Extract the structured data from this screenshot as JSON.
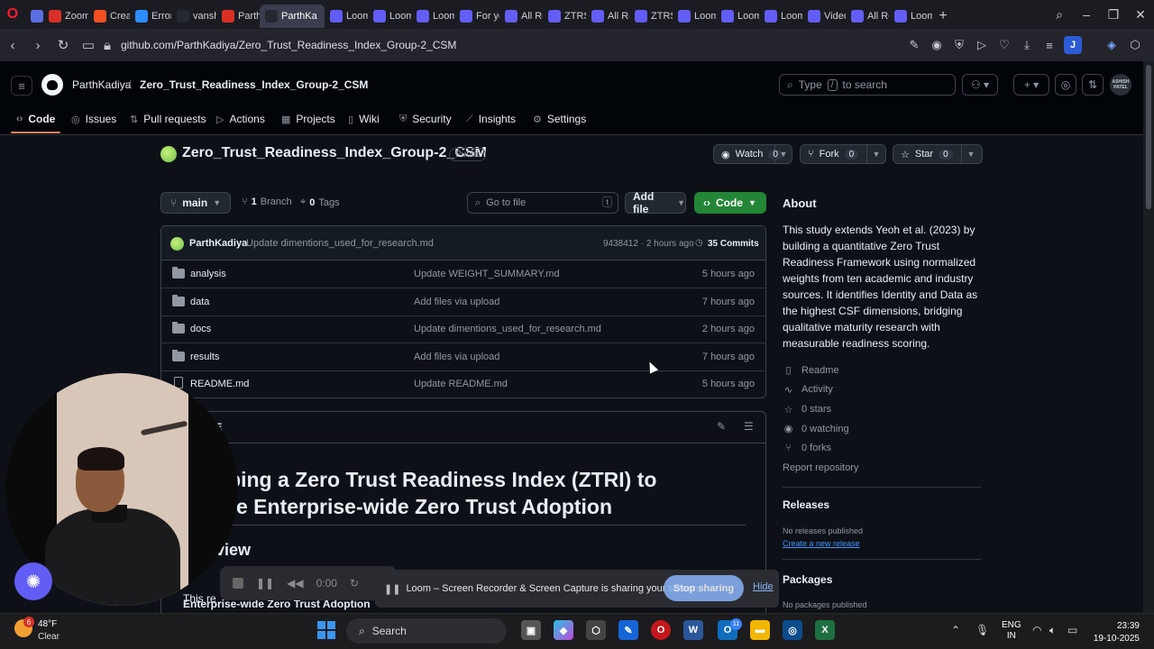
{
  "browser": {
    "tabs": [
      {
        "label": "",
        "icon": "settings-icon",
        "color": "#5b6ee1",
        "active": false
      },
      {
        "label": "Zoom",
        "icon": "gmail-icon",
        "color": "#d93025",
        "active": false
      },
      {
        "label": "Create",
        "icon": "microsoft-icon",
        "color": "#f25022",
        "active": false
      },
      {
        "label": "Error",
        "icon": "zoom-icon",
        "color": "#2d8cff",
        "active": false
      },
      {
        "label": "vansh",
        "icon": "github-icon",
        "color": "#24292f",
        "active": false
      },
      {
        "label": "Parth",
        "icon": "gmail-icon",
        "color": "#d93025",
        "active": false
      },
      {
        "label": "ParthKa",
        "icon": "github-icon",
        "color": "#24292f",
        "active": true
      },
      {
        "label": "Loom",
        "icon": "loom-icon",
        "color": "#625df5",
        "active": false
      },
      {
        "label": "Loom",
        "icon": "loom-icon",
        "color": "#625df5",
        "active": false
      },
      {
        "label": "Loom",
        "icon": "loom-icon",
        "color": "#625df5",
        "active": false
      },
      {
        "label": "For yo",
        "icon": "loom-icon",
        "color": "#625df5",
        "active": false
      },
      {
        "label": "All Re",
        "icon": "loom-icon",
        "color": "#625df5",
        "active": false
      },
      {
        "label": "ZTRS",
        "icon": "loom-icon",
        "color": "#625df5",
        "active": false
      },
      {
        "label": "All Re",
        "icon": "loom-icon",
        "color": "#625df5",
        "active": false
      },
      {
        "label": "ZTRS",
        "icon": "loom-icon",
        "color": "#625df5",
        "active": false
      },
      {
        "label": "Loom",
        "icon": "loom-icon",
        "color": "#625df5",
        "active": false
      },
      {
        "label": "Loom",
        "icon": "loom-icon",
        "color": "#625df5",
        "active": false
      },
      {
        "label": "Loom",
        "icon": "loom-icon",
        "color": "#625df5",
        "active": false
      },
      {
        "label": "Video",
        "icon": "loom-icon",
        "color": "#625df5",
        "active": false
      },
      {
        "label": "All Re",
        "icon": "loom-icon",
        "color": "#625df5",
        "active": false
      },
      {
        "label": "Loom",
        "icon": "loom-icon",
        "color": "#625df5",
        "active": false
      }
    ],
    "url": "github.com/ParthKadiya/Zero_Trust_Readiness_Index_Group-2_CSM",
    "profile_initial": "J"
  },
  "header": {
    "owner": "ParthKadiya",
    "separator": "/",
    "repo": "Zero_Trust_Readiness_Index_Group-2_CSM",
    "search_placeholder_pre": "Type",
    "search_key": "/",
    "search_placeholder_post": "to search",
    "avatar_text": "ASHISH PATEL"
  },
  "repo_nav": [
    {
      "label": "Code",
      "icon": "code-icon"
    },
    {
      "label": "Issues",
      "icon": "issue-icon"
    },
    {
      "label": "Pull requests",
      "icon": "pull-request-icon"
    },
    {
      "label": "Actions",
      "icon": "play-icon"
    },
    {
      "label": "Projects",
      "icon": "table-icon"
    },
    {
      "label": "Wiki",
      "icon": "book-icon"
    },
    {
      "label": "Security",
      "icon": "shield-icon"
    },
    {
      "label": "Insights",
      "icon": "graph-icon"
    },
    {
      "label": "Settings",
      "icon": "gear-icon"
    }
  ],
  "repo": {
    "title": "Zero_Trust_Readiness_Index_Group-2_CSM",
    "visibility": "Public",
    "watch_label": "Watch",
    "watch_count": "0",
    "fork_label": "Fork",
    "fork_count": "0",
    "star_label": "Star",
    "star_count": "0"
  },
  "toolbar": {
    "branch": "main",
    "branches_count": "1",
    "branches_label": "Branch",
    "tags_count": "0",
    "tags_label": "Tags",
    "goto_placeholder": "Go to file",
    "goto_key": "t",
    "add_file": "Add file",
    "code": "Code"
  },
  "latest_commit": {
    "author": "ParthKadiya",
    "message": "Update dimentions_used_for_research.md",
    "hash_time": "9438412 · 2 hours ago",
    "commits": "35 Commits"
  },
  "files": [
    {
      "name": "analysis",
      "type": "folder",
      "message": "Update WEIGHT_SUMMARY.md",
      "time": "5 hours ago"
    },
    {
      "name": "data",
      "type": "folder",
      "message": "Add files via upload",
      "time": "7 hours ago"
    },
    {
      "name": "docs",
      "type": "folder",
      "message": "Update dimentions_used_for_research.md",
      "time": "2 hours ago"
    },
    {
      "name": "results",
      "type": "folder",
      "message": "Add files via upload",
      "time": "7 hours ago"
    },
    {
      "name": "README.md",
      "type": "file",
      "message": "Update README.md",
      "time": "5 hours ago"
    }
  ],
  "readme": {
    "tab_label": "E",
    "title_line1": "oping a Zero Trust Readiness Index (ZTRI) to",
    "title_line2": "ure Enterprise-wide Zero Trust Adoption",
    "h2": "view",
    "para_pre": "This re",
    "para_bold": "Enterprise-wide Zero Trust Adoption"
  },
  "about": {
    "heading": "About",
    "description": "This study extends Yeoh et al. (2023) by building a quantitative Zero Trust Readiness Framework using normalized weights from ten academic and industry sources. It identifies Identity and Data as the highest CSF dimensions, bridging qualitative maturity research with measurable readiness scoring.",
    "links": [
      {
        "label": "Readme",
        "icon": "book-icon"
      },
      {
        "label": "Activity",
        "icon": "pulse-icon"
      },
      {
        "label": "0 stars",
        "icon": "star-icon"
      },
      {
        "label": "0 watching",
        "icon": "eye-icon"
      },
      {
        "label": "0 forks",
        "icon": "fork-icon"
      }
    ],
    "report": "Report repository",
    "releases_heading": "Releases",
    "releases_none": "No releases published",
    "releases_create": "Create a new release",
    "packages_heading": "Packages",
    "packages_none": "No packages published"
  },
  "loom": {
    "timer": "0:00",
    "share_text": "Loom – Screen Recorder & Screen Capture is sharing your screen.",
    "stop": "Stop sharing",
    "hide": "Hide"
  },
  "taskbar": {
    "weather_temp": "48°F",
    "weather_desc": "Clear",
    "weather_badge": "6",
    "search": "Search",
    "lang_line1": "ENG",
    "lang_line2": "IN",
    "time": "23:39",
    "date": "19-10-2025",
    "notif_count": "11"
  }
}
